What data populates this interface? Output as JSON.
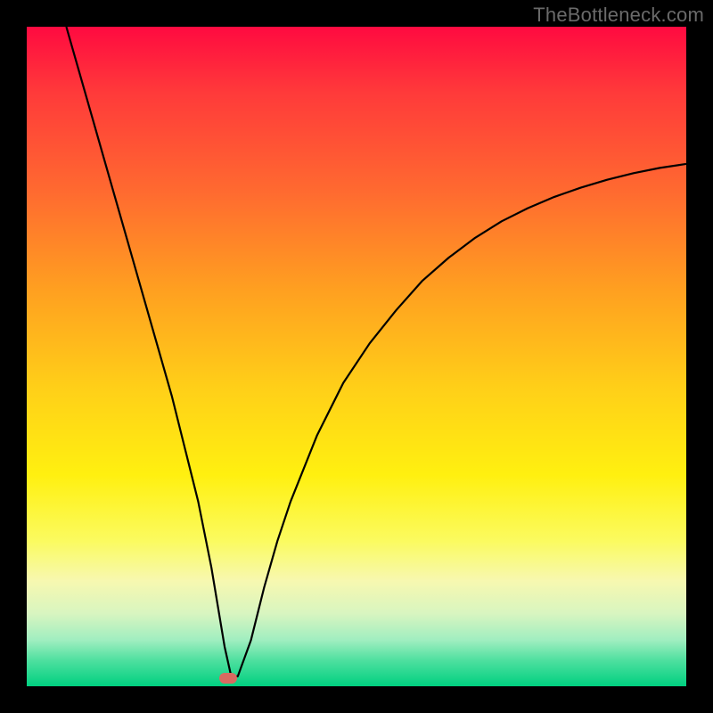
{
  "watermark": "TheBottleneck.com",
  "chart_data": {
    "type": "line",
    "title": "",
    "xlabel": "",
    "ylabel": "",
    "xlim": [
      0,
      100
    ],
    "ylim": [
      0,
      100
    ],
    "grid": false,
    "legend": false,
    "series": [
      {
        "name": "curve",
        "color": "#000000",
        "x": [
          6,
          8,
          10,
          12,
          14,
          16,
          18,
          20,
          22,
          24,
          26,
          28,
          29,
          30,
          31,
          32,
          34,
          36,
          38,
          40,
          44,
          48,
          52,
          56,
          60,
          64,
          68,
          72,
          76,
          80,
          84,
          88,
          92,
          96,
          100
        ],
        "y": [
          100,
          93,
          86,
          79,
          72,
          65,
          58,
          51,
          44,
          36,
          28,
          18,
          12,
          6,
          1.5,
          1.5,
          7,
          15,
          22,
          28,
          38,
          46,
          52,
          57,
          61.5,
          65,
          68,
          70.5,
          72.5,
          74.2,
          75.6,
          76.8,
          77.8,
          78.6,
          79.2
        ]
      }
    ],
    "marker": {
      "x": 30.5,
      "y": 1.2,
      "color": "#d86a60"
    },
    "background_gradient": {
      "top": "#ff0a40",
      "mid": "#ffe010",
      "bottom": "#00d080"
    }
  }
}
